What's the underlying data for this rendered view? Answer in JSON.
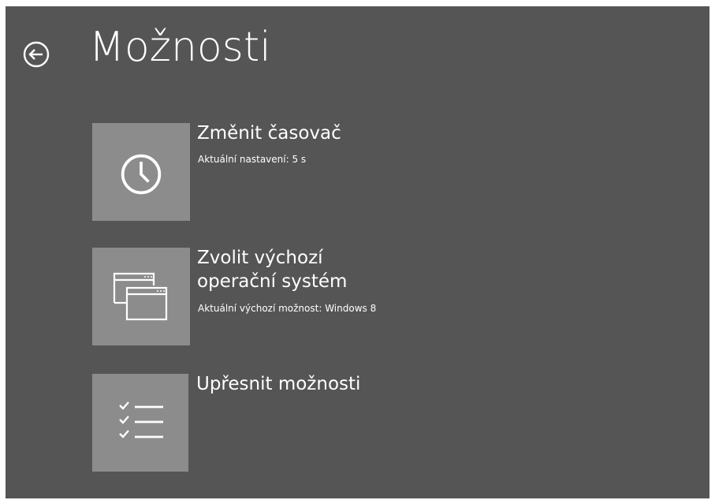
{
  "colors": {
    "background": "#555555",
    "tile": "#8c8c8c",
    "text": "#ffffff"
  },
  "header": {
    "back_icon": "back-arrow-circle-icon",
    "title": "Možnosti"
  },
  "options": [
    {
      "icon": "clock-icon",
      "title": "Změnit časovač",
      "subtitle": "Aktuální nastavení: 5 s"
    },
    {
      "icon": "windows-icon",
      "title_line1": "Zvolit výchozí",
      "title_line2": "operační systém",
      "subtitle": "Aktuální výchozí možnost: Windows 8"
    },
    {
      "icon": "checklist-icon",
      "title": "Upřesnit možnosti"
    }
  ]
}
